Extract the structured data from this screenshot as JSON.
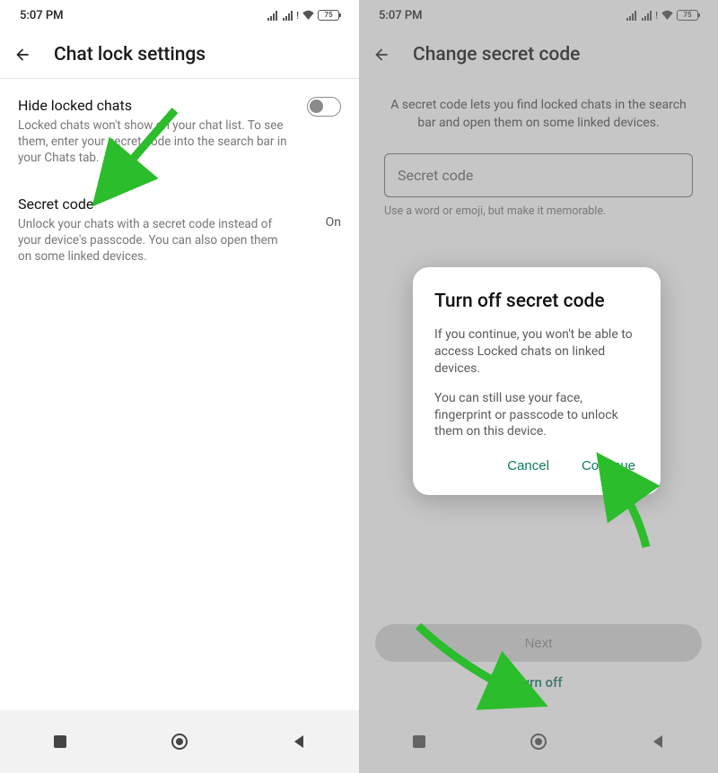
{
  "status": {
    "time": "5:07 PM",
    "battery": "75"
  },
  "left": {
    "title": "Chat lock settings",
    "hide": {
      "title": "Hide locked chats",
      "desc": "Locked chats won't show on your chat list. To see them, enter your secret code into the search bar in your Chats tab."
    },
    "secret": {
      "title": "Secret code",
      "desc": "Unlock your chats with a secret code instead of your device's passcode. You can also open them on some linked devices.",
      "value": "On"
    }
  },
  "right": {
    "title": "Change secret code",
    "desc": "A secret code lets you find locked chats in the search bar and open them on some linked devices.",
    "placeholder": "Secret code",
    "hint": "Use a word or emoji, but make it memorable.",
    "next": "Next",
    "turnoff": "Turn off",
    "dialog": {
      "title": "Turn off secret code",
      "p1": "If you continue, you won't be able to access Locked chats on linked devices.",
      "p2": "You can still use your face, fingerprint or passcode to unlock them on this device.",
      "cancel": "Cancel",
      "continue": "Continue"
    }
  }
}
